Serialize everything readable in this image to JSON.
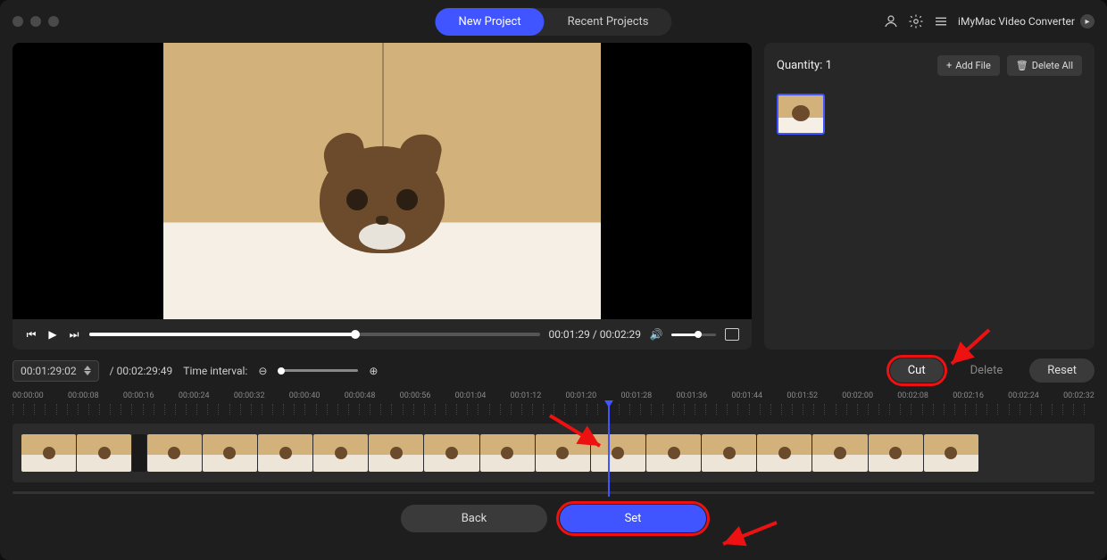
{
  "header": {
    "tabs": {
      "new_project": "New Project",
      "recent_projects": "Recent Projects"
    },
    "brand": "iMyMac Video Converter"
  },
  "player": {
    "current_time": "00:01:29",
    "total_time": "00:02:29",
    "progress_percent": 59
  },
  "side": {
    "quantity_label": "Quantity:",
    "quantity_value": "1",
    "add_file": "Add File",
    "delete_all": "Delete All"
  },
  "toolbar": {
    "timecode": "00:01:29:02",
    "duration": "00:02:29:49",
    "interval_label": "Time interval:",
    "cut": "Cut",
    "delete": "Delete",
    "reset": "Reset"
  },
  "ruler": [
    "00:00:00",
    "00:00:08",
    "00:00:16",
    "00:00:24",
    "00:00:32",
    "00:00:40",
    "00:00:48",
    "00:00:56",
    "00:01:04",
    "00:01:12",
    "00:01:20",
    "00:01:28",
    "00:01:36",
    "00:01:44",
    "00:01:52",
    "00:02:00",
    "00:02:08",
    "00:02:16",
    "00:02:24",
    "00:02:32"
  ],
  "timeline": {
    "playhead_percent": 55
  },
  "footer": {
    "back": "Back",
    "set": "Set"
  }
}
